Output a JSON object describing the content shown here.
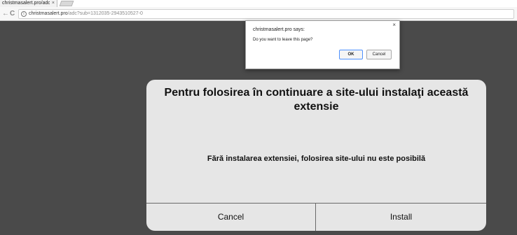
{
  "browser": {
    "tab": {
      "title": "christmasalert.pro/adc?s",
      "close": "×"
    },
    "nav": {
      "back": "←",
      "forward": "→",
      "reload": "C"
    },
    "url": {
      "host": "christmasalert.pro",
      "path": "/adc?sub=1312035-2943510527-0"
    }
  },
  "alert": {
    "title": "christmasalert.pro says:",
    "message": "Do you want to leave this page?",
    "close": "×",
    "ok_label": "OK",
    "cancel_label": "Cancel"
  },
  "modal": {
    "title": "Pentru folosirea în continuare a site-ului instalaţi această extensie",
    "message": "Fără instalarea extensiei, folosirea site-ului nu este posibilă",
    "cancel_label": "Cancel",
    "install_label": "Install"
  },
  "colors": {
    "page_background": "#4a4a4a",
    "modal_background": "#e6e6e6",
    "alert_ok_focus": "#4d90fe"
  }
}
